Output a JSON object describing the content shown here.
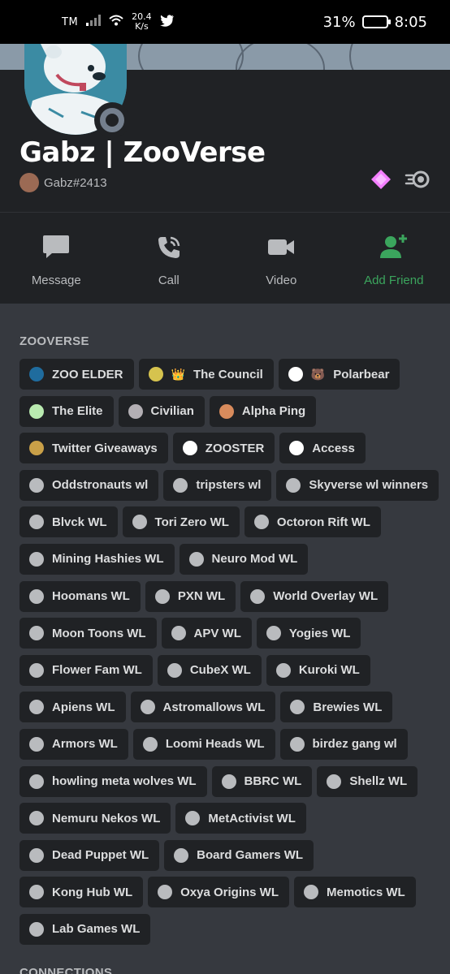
{
  "status_bar": {
    "carrier": "TM",
    "speed_value": "20.4",
    "speed_unit": "K/s",
    "battery": "31%",
    "time": "8:05",
    "battery_level": 0.31
  },
  "profile": {
    "display_name": "Gabz | ZooVerse",
    "tag": "Gabz#2413",
    "status": "offline",
    "badges": [
      "hypesquad-icon",
      "nitro-icon"
    ]
  },
  "actions": [
    {
      "label": "Message",
      "icon": "message-icon"
    },
    {
      "label": "Call",
      "icon": "call-icon"
    },
    {
      "label": "Video",
      "icon": "video-icon"
    },
    {
      "label": "Add Friend",
      "icon": "add-friend-icon"
    }
  ],
  "roles_section": {
    "title": "ZOOVERSE",
    "rows": [
      [
        {
          "label": "ZOO ELDER",
          "color": "#1f6c9e"
        },
        {
          "label": "The Council",
          "color": "#d6c34e",
          "emoji": "👑"
        },
        {
          "label": "Polarbear",
          "color": "#ffffff",
          "emoji": "🐻"
        }
      ],
      [
        {
          "label": "The Elite",
          "color": "#b9eab0"
        },
        {
          "label": "Civilian",
          "color": "#b3afb4"
        },
        {
          "label": "Alpha Ping",
          "color": "#d88b5c"
        }
      ],
      [
        {
          "label": "Twitter Giveaways",
          "color": "#c9a048"
        },
        {
          "label": "ZOOSTER",
          "color": "#ffffff"
        },
        {
          "label": "Access",
          "color": "#ffffff"
        }
      ],
      [
        {
          "label": "Oddstronauts wl",
          "color": "#b9bbbe"
        },
        {
          "label": "tripsters wl",
          "color": "#b9bbbe"
        },
        {
          "label": "Skyverse wl winners",
          "color": "#b9bbbe"
        }
      ],
      [
        {
          "label": "Blvck WL",
          "color": "#b9bbbe"
        },
        {
          "label": "Tori Zero WL",
          "color": "#b9bbbe"
        },
        {
          "label": "Octoron Rift WL",
          "color": "#b9bbbe"
        }
      ],
      [
        {
          "label": "Mining Hashies WL",
          "color": "#b9bbbe"
        },
        {
          "label": "Neuro Mod WL",
          "color": "#b9bbbe"
        }
      ],
      [
        {
          "label": "Hoomans WL",
          "color": "#b9bbbe"
        },
        {
          "label": "PXN WL",
          "color": "#b9bbbe"
        },
        {
          "label": "World Overlay WL",
          "color": "#b9bbbe"
        }
      ],
      [
        {
          "label": "Moon Toons WL",
          "color": "#b9bbbe"
        },
        {
          "label": "APV WL",
          "color": "#b9bbbe"
        },
        {
          "label": "Yogies WL",
          "color": "#b9bbbe"
        }
      ],
      [
        {
          "label": "Flower Fam WL",
          "color": "#b9bbbe"
        },
        {
          "label": "CubeX WL",
          "color": "#b9bbbe"
        },
        {
          "label": "Kuroki WL",
          "color": "#b9bbbe"
        }
      ],
      [
        {
          "label": "Apiens WL",
          "color": "#b9bbbe"
        },
        {
          "label": "Astromallows WL",
          "color": "#b9bbbe"
        },
        {
          "label": "Brewies WL",
          "color": "#b9bbbe"
        }
      ],
      [
        {
          "label": "Armors WL",
          "color": "#b9bbbe"
        },
        {
          "label": "Loomi Heads WL",
          "color": "#b9bbbe"
        },
        {
          "label": "birdez gang wl",
          "color": "#b9bbbe"
        }
      ],
      [
        {
          "label": "howling meta wolves WL",
          "color": "#b9bbbe"
        },
        {
          "label": "BBRC WL",
          "color": "#b9bbbe"
        },
        {
          "label": "Shellz WL",
          "color": "#b9bbbe"
        }
      ],
      [
        {
          "label": "Nemuru Nekos WL",
          "color": "#b9bbbe"
        },
        {
          "label": "MetActivist WL",
          "color": "#b9bbbe"
        }
      ],
      [
        {
          "label": "Dead Puppet WL",
          "color": "#b9bbbe"
        },
        {
          "label": "Board Gamers WL",
          "color": "#b9bbbe"
        }
      ],
      [
        {
          "label": "Kong Hub WL",
          "color": "#b9bbbe"
        },
        {
          "label": "Oxya Origins WL",
          "color": "#b9bbbe"
        },
        {
          "label": "Memotics WL",
          "color": "#b9bbbe"
        }
      ],
      [
        {
          "label": "Lab Games WL",
          "color": "#b9bbbe"
        }
      ]
    ]
  },
  "connections_section": {
    "title": "CONNECTIONS"
  }
}
